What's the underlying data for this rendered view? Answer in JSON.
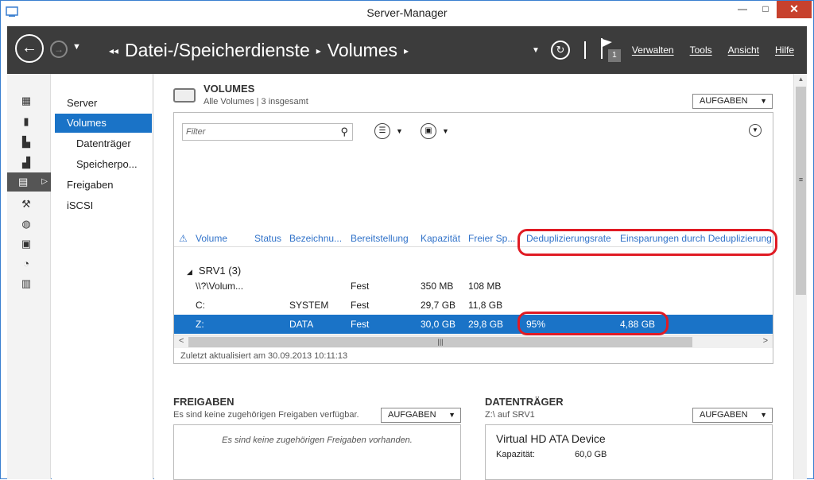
{
  "window": {
    "title": "Server-Manager",
    "min": "—",
    "max": "□",
    "close": "✕"
  },
  "header": {
    "back_icon": "←",
    "forward_icon": "→",
    "history_dropdown": "▼",
    "breadcrumb_prefix": "◂◂",
    "breadcrumbs": [
      "Datei-/Speicherdienste",
      "Volumes"
    ],
    "breadcrumb_sep": "▸",
    "refresh_icon": "↻",
    "flag_count": "1",
    "menu": [
      "Verwalten",
      "Tools",
      "Ansicht",
      "Hilfe"
    ]
  },
  "sidebar_icons": [
    "dashboard-icon",
    "local-server-icon",
    "all-servers-icon",
    "roles-icon",
    "file-storage-icon",
    "tools-icon",
    "iis-icon",
    "print-icon",
    "rds-icon",
    "wsus-icon"
  ],
  "nav": {
    "items": [
      "Server",
      "Volumes",
      "Datenträger",
      "Speicherpo...",
      "Freigaben",
      "iSCSI"
    ]
  },
  "volumes": {
    "title": "VOLUMES",
    "subtitle": "Alle Volumes | 3 insgesamt",
    "tasks": "AUFGABEN",
    "filter_placeholder": "Filter",
    "columns": [
      "Volume",
      "Status",
      "Bezeichnu...",
      "Bereitstellung",
      "Kapazität",
      "Freier Sp...",
      "Deduplizierungsrate",
      "Einsparungen durch Deduplizierung"
    ],
    "group": "SRV1 (3)",
    "rows": [
      {
        "volume": "\\\\?\\Volum...",
        "status": "",
        "label": "",
        "provisioning": "Fest",
        "capacity": "350 MB",
        "free": "108 MB",
        "dedup_rate": "",
        "savings": ""
      },
      {
        "volume": "C:",
        "status": "",
        "label": "SYSTEM",
        "provisioning": "Fest",
        "capacity": "29,7 GB",
        "free": "11,8 GB",
        "dedup_rate": "",
        "savings": ""
      },
      {
        "volume": "Z:",
        "status": "",
        "label": "DATA",
        "provisioning": "Fest",
        "capacity": "30,0 GB",
        "free": "29,8 GB",
        "dedup_rate": "95%",
        "savings": "4,88 GB"
      }
    ],
    "updated": "Zuletzt aktualisiert am 30.09.2013 10:11:13"
  },
  "shares": {
    "title": "FREIGABEN",
    "subtitle": "Es sind keine zugehörigen Freigaben verfügbar.",
    "tasks": "AUFGABEN",
    "empty": "Es sind keine zugehörigen Freigaben vorhanden."
  },
  "disks": {
    "title": "DATENTRÄGER",
    "subtitle": "Z:\\ auf SRV1",
    "tasks": "AUFGABEN",
    "device": "Virtual HD ATA Device",
    "capacity_label": "Kapazität:",
    "capacity_value": "60,0 GB"
  },
  "colors": {
    "accent": "#1a73c7",
    "header_bg": "#3c3c3c",
    "highlight": "#e01b24",
    "link": "#3072c9"
  }
}
